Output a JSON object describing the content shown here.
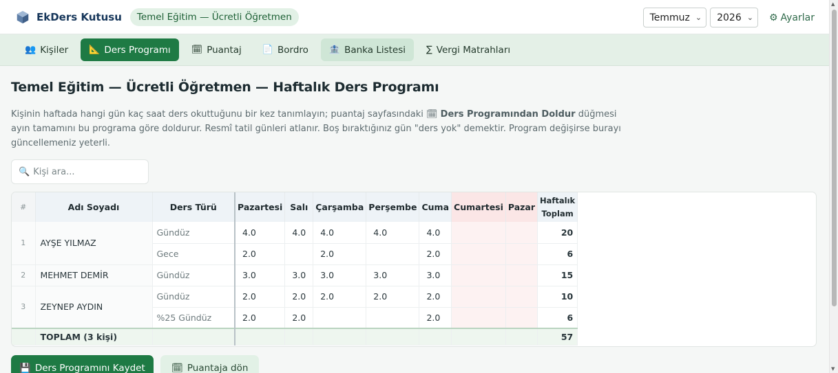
{
  "app": {
    "title": "EkDers Kutusu",
    "context_badge": "Temel Eğitim — Ücretli Öğretmen",
    "month": "Temmuz",
    "year": "2026",
    "settings_label": "Ayarlar"
  },
  "tabs": [
    {
      "label": "Kişiler",
      "icon": "people-icon",
      "glyph": "👥"
    },
    {
      "label": "Ders Programı",
      "icon": "ruler-triangle-icon",
      "glyph": "📐"
    },
    {
      "label": "Puantaj",
      "icon": "calendar-icon",
      "glyph": "🗓"
    },
    {
      "label": "Bordro",
      "icon": "document-icon",
      "glyph": "📄"
    },
    {
      "label": "Banka Listesi",
      "icon": "bank-icon",
      "glyph": "🏦"
    },
    {
      "label": "Vergi Matrahları",
      "icon": "sigma-icon",
      "glyph": "∑"
    }
  ],
  "page": {
    "title": "Temel Eğitim — Ücretli Öğretmen — Haftalık Ders Programı",
    "desc_part1": "Kişinin haftada hangi gün kaç saat ders okuttuğunu bir kez tanımlayın; puantaj sayfasındaki ",
    "desc_bold": "Ders Programından Doldur",
    "desc_part2": " düğmesi ayın tamamını bu programa göre doldurur. Resmî tatil günleri atlanır. Boş bıraktığınız gün \"ders yok\" demektir. Program değişirse burayı güncellemeniz yeterli.",
    "search_placeholder": "Kişi ara..."
  },
  "table": {
    "headers": {
      "index": "#",
      "name": "Adı Soyadı",
      "type": "Ders Türü",
      "days": [
        "Pazartesi",
        "Salı",
        "Çarşamba",
        "Perşembe",
        "Cuma",
        "Cumartesi",
        "Pazar"
      ],
      "total": "Haftalık Toplam"
    },
    "people": [
      {
        "index": "1",
        "name": "AYŞE YILMAZ",
        "rows": [
          {
            "type": "Gündüz",
            "days": [
              "4.0",
              "4.0",
              "4.0",
              "4.0",
              "4.0",
              "",
              ""
            ],
            "total": "20"
          },
          {
            "type": "Gece",
            "days": [
              "2.0",
              "",
              "2.0",
              "",
              "2.0",
              "",
              ""
            ],
            "total": "6"
          }
        ]
      },
      {
        "index": "2",
        "name": "MEHMET DEMİR",
        "rows": [
          {
            "type": "Gündüz",
            "days": [
              "3.0",
              "3.0",
              "3.0",
              "3.0",
              "3.0",
              "",
              ""
            ],
            "total": "15"
          }
        ]
      },
      {
        "index": "3",
        "name": "ZEYNEP AYDIN",
        "rows": [
          {
            "type": "Gündüz",
            "days": [
              "2.0",
              "2.0",
              "2.0",
              "2.0",
              "2.0",
              "",
              ""
            ],
            "total": "10"
          },
          {
            "type": "%25 Gündüz",
            "days": [
              "2.0",
              "2.0",
              "",
              "",
              "2.0",
              "",
              ""
            ],
            "total": "6"
          }
        ]
      }
    ],
    "summary": {
      "label": "TOPLAM (3 kişi)",
      "total": "57"
    }
  },
  "actions": {
    "save_label": "Ders Programını Kaydet",
    "back_label": "Puantaja dön"
  },
  "colors": {
    "primary": "#1e7a44",
    "weekend": "#fdf2f2",
    "tabbar": "#e4f0e7"
  }
}
